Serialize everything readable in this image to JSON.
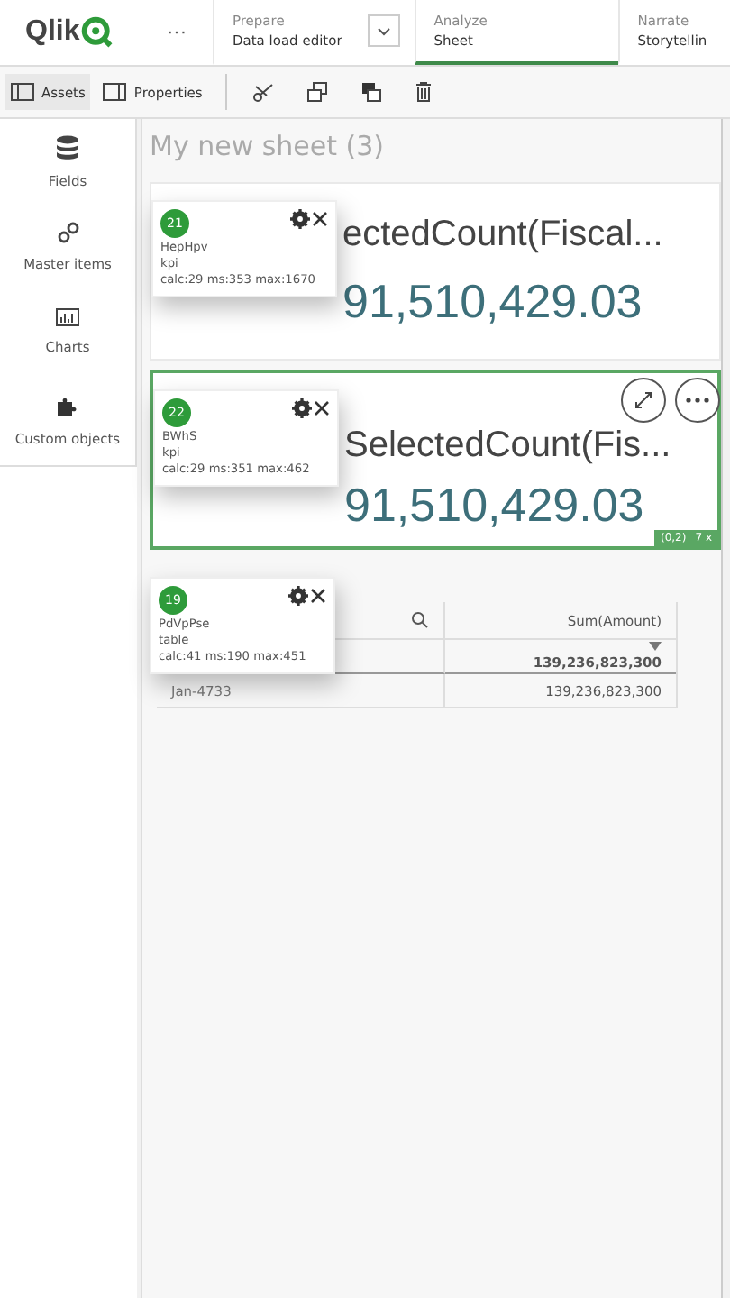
{
  "header": {
    "logo": "Qlik",
    "more": "···",
    "sections": [
      {
        "caption": "Prepare",
        "label": "Data load editor",
        "dropdown": true,
        "selected": false
      },
      {
        "caption": "Analyze",
        "label": "Sheet",
        "dropdown": false,
        "selected": true
      },
      {
        "caption": "Narrate",
        "label": "Storytellin",
        "dropdown": false,
        "selected": false
      }
    ]
  },
  "toolbar": {
    "panels": [
      {
        "label": "Assets",
        "selected": true
      },
      {
        "label": "Properties",
        "selected": false
      }
    ]
  },
  "sidebar": {
    "items": [
      {
        "kind": "fields",
        "label": "Fields"
      },
      {
        "kind": "master",
        "label": "Master items"
      },
      {
        "kind": "charts",
        "label": "Charts"
      },
      {
        "kind": "custom",
        "label": "Custom objects"
      }
    ]
  },
  "sheet": {
    "title": "My new sheet (3)",
    "kpis": [
      {
        "title": "ectedCount(Fiscal...",
        "value": "91,510,429.03",
        "selected": false,
        "popup": {
          "number": "21",
          "id": "HepHpv",
          "type": "kpi",
          "stats": "calc:29 ms:353 max:1670"
        }
      },
      {
        "title": "SelectedCount(Fis...",
        "value": "91,510,429.03",
        "selected": true,
        "popup": {
          "number": "22",
          "id": "BWhS",
          "type": "kpi",
          "stats": "calc:29 ms:351 max:462"
        },
        "footer": [
          "(0,2)",
          "7 x"
        ]
      }
    ],
    "table": {
      "popup": {
        "number": "19",
        "id": "PdVpPse",
        "type": "table",
        "stats": "calc:41 ms:190 max:451"
      },
      "columns": [
        {
          "searchable": true
        },
        {
          "heading": "Sum(Amount)",
          "searchable": false
        }
      ],
      "total": "139,236,823,300",
      "rows": [
        [
          "Jan-4733",
          "139,236,823,300"
        ]
      ]
    }
  }
}
